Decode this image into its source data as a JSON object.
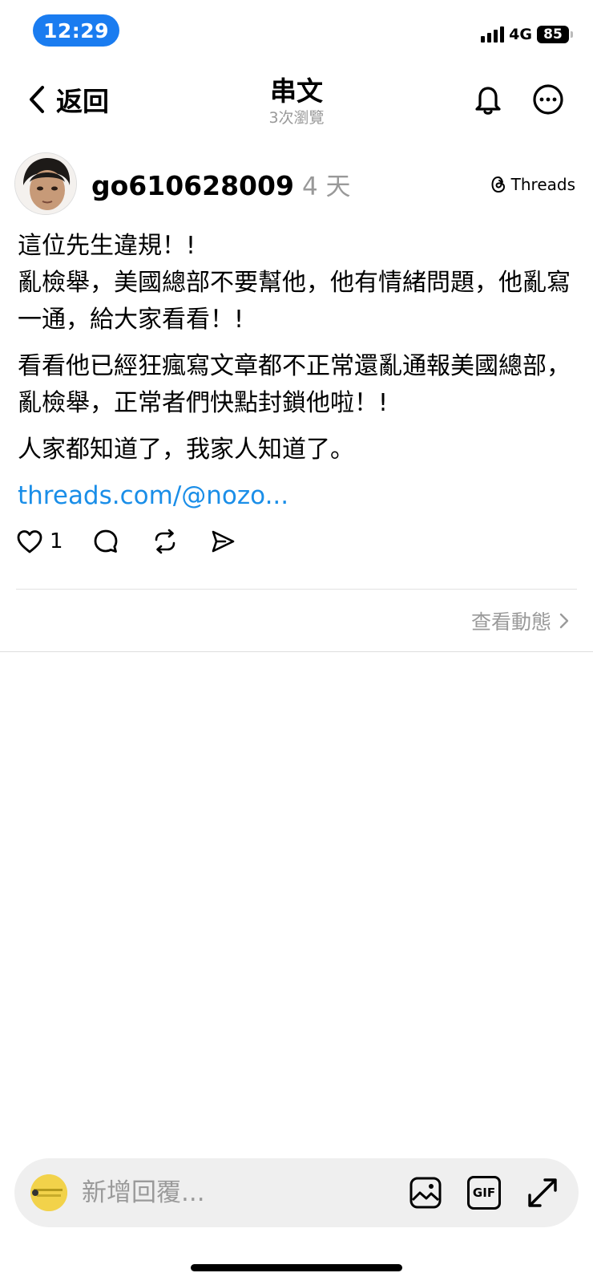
{
  "status_bar": {
    "time": "12:29",
    "network": "4G",
    "battery": "85"
  },
  "nav": {
    "back_label": "返回",
    "title": "串文",
    "views": "3次瀏覽"
  },
  "post": {
    "username": "go610628009",
    "age": "4 天",
    "source_label": "Threads",
    "paragraphs": [
      "這位先生違規！!\n亂檢舉，美國總部不要幫他，他有情緒問題，他亂寫一通，給大家看看！!",
      "看看他已經狂瘋寫文章都不正常還亂通報美國總部，亂檢舉，正常者們快點封鎖他啦！!",
      "人家都知道了，我家人知道了。"
    ],
    "link_text": "threads.com/@nozo...",
    "like_count": "1",
    "activity_label": "查看動態"
  },
  "composer": {
    "placeholder": "新增回覆...",
    "gif_label": "GIF"
  },
  "colors": {
    "accent_blue": "#1a7cf0",
    "link_blue": "#1a8ee8",
    "muted_gray": "#999999"
  }
}
